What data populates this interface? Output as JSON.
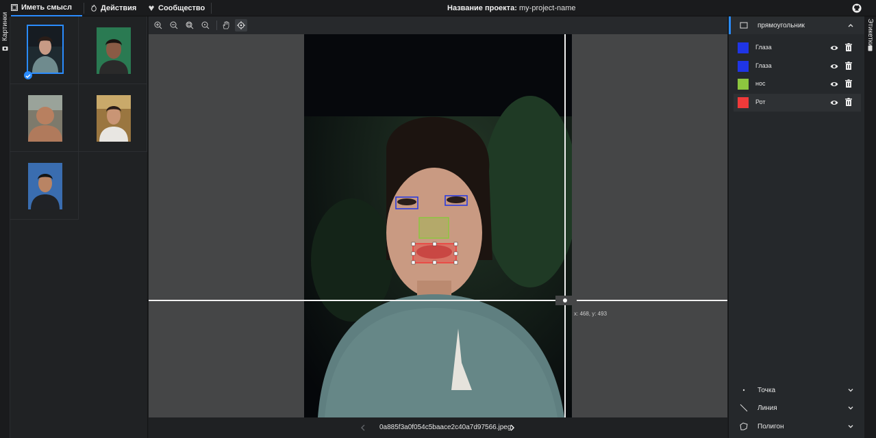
{
  "topbar": {
    "nav": [
      {
        "label": "Иметь смысл",
        "icon": "image-icon"
      },
      {
        "label": "Действия",
        "icon": "flame-icon"
      },
      {
        "label": "Сообщество",
        "icon": "community-icon"
      }
    ],
    "project_label": "Название проекта:",
    "project_name": "my-project-name",
    "github_icon": "github-icon"
  },
  "left_tab": {
    "label": "Картинки"
  },
  "right_tab": {
    "label": "Этикетки"
  },
  "toolbar": {
    "tools": [
      "zoom-in-icon",
      "zoom-out-icon",
      "zoom-fit-icon",
      "zoom-actual-icon",
      "hand-icon",
      "crosshair-icon"
    ]
  },
  "canvas": {
    "cursor_coords": "x: 468, y: 493"
  },
  "footer": {
    "filename": "0a885f3a0f054c5baace2c40a7d97566.jpeg"
  },
  "right_panel": {
    "rect_section": "прямоугольник",
    "labels": [
      {
        "name": "Глаза",
        "color": "#1f35e6"
      },
      {
        "name": "Глаза",
        "color": "#1f35e6"
      },
      {
        "name": "нос",
        "color": "#8cc63f"
      },
      {
        "name": "Рот",
        "color": "#ef3a3a"
      }
    ],
    "sections": [
      "Точка",
      "Линия",
      "Полигон"
    ]
  },
  "colors": {
    "accent": "#2a8cff"
  }
}
